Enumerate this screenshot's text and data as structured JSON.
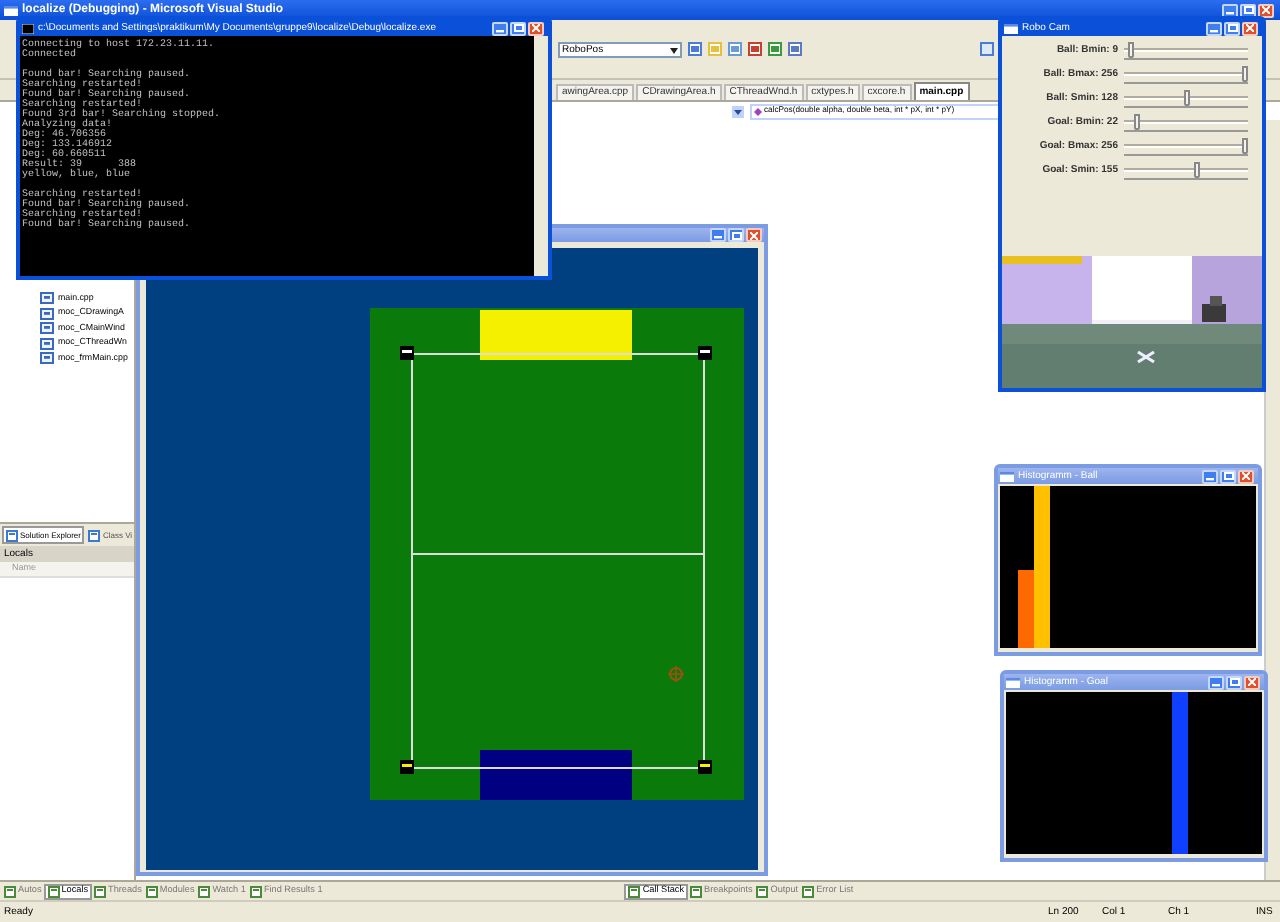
{
  "ide": {
    "title": "localize (Debugging) - Microsoft Visual Studio",
    "project_combo": "RoboPos",
    "editor_tabs": [
      {
        "label": "awingArea.cpp",
        "selected": false
      },
      {
        "label": "CDrawingArea.h",
        "selected": false
      },
      {
        "label": "CThreadWnd.h",
        "selected": false
      },
      {
        "label": "cxtypes.h",
        "selected": false
      },
      {
        "label": "cxcore.h",
        "selected": false
      },
      {
        "label": "main.cpp",
        "selected": true
      }
    ],
    "function_combo": "calcPos(double alpha, double beta, int * pX, int * pY)"
  },
  "solution_explorer": {
    "items": [
      "main.cpp",
      "moc_CDrawingA",
      "moc_CMainWind",
      "moc_CThreadWn",
      "moc_frmMain.cpp"
    ],
    "tabs": [
      {
        "label": "Solution Explorer",
        "selected": true
      },
      {
        "label": "Class Vi",
        "selected": false
      }
    ]
  },
  "locals": {
    "title": "Locals",
    "column": "Name"
  },
  "console": {
    "title": "c:\\Documents and Settings\\praktikum\\My Documents\\gruppe9\\localize\\Debug\\localize.exe",
    "blocks": [
      [
        "Connecting to host 172.23.11.11.",
        "Connected"
      ],
      [
        "Found bar! Searching paused.",
        "Searching restarted!",
        "Found bar! Searching paused.",
        "Searching restarted!",
        "Found 3rd bar! Searching stopped.",
        "Analyzing data!",
        "Deg: 46.706356",
        "Deg: 133.146912",
        "Deg: 60.660511",
        "Result: 39      388",
        "yellow, blue, blue"
      ],
      [
        "Searching restarted!",
        "Found bar! Searching paused.",
        "Searching restarted!",
        "Found bar! Searching paused."
      ]
    ]
  },
  "robo_cam": {
    "title": "Robo Cam",
    "sliders": [
      {
        "label": "Ball: Bmin: 9",
        "level": 0.04
      },
      {
        "label": "Ball: Bmax: 256",
        "level": 1.0
      },
      {
        "label": "Ball: Smin: 128",
        "level": 0.5
      },
      {
        "label": "Goal: Bmin: 22",
        "level": 0.09
      },
      {
        "label": "Goal: Bmax: 256",
        "level": 1.0
      },
      {
        "label": "Goal: Smin: 155",
        "level": 0.6
      }
    ]
  },
  "histograms": [
    {
      "title": "Histogramm - Ball",
      "kind": "ball"
    },
    {
      "title": "Histogramm - Goal",
      "kind": "goal"
    }
  ],
  "bottom_tabs_left": [
    {
      "label": "Autos",
      "selected": false
    },
    {
      "label": "Locals",
      "selected": true
    },
    {
      "label": "Threads",
      "selected": false
    },
    {
      "label": "Modules",
      "selected": false
    },
    {
      "label": "Watch 1",
      "selected": false
    },
    {
      "label": "Find Results 1",
      "selected": false
    }
  ],
  "bottom_tabs_right": [
    {
      "label": "Call Stack",
      "selected": true
    },
    {
      "label": "Breakpoints",
      "selected": false
    },
    {
      "label": "Output",
      "selected": false
    },
    {
      "label": "Error List",
      "selected": false
    }
  ],
  "status_bar": {
    "message": "Ready",
    "line": "Ln 200",
    "column": "Col 1",
    "char": "Ch 1",
    "mode": "INS"
  }
}
